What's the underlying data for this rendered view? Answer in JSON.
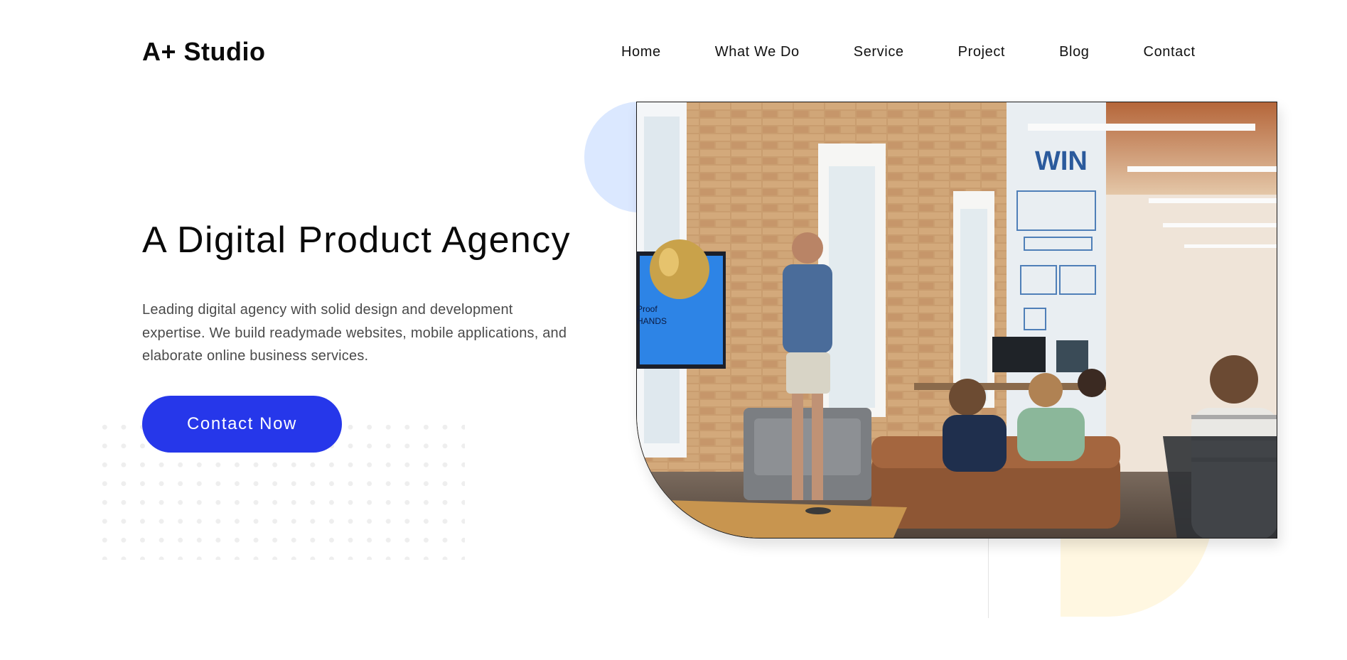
{
  "header": {
    "brand": "A+ Studio",
    "nav": [
      "Home",
      "What We Do",
      "Service",
      "Project",
      "Blog",
      "Contact"
    ]
  },
  "hero": {
    "title": "A Digital Product Agency",
    "description": "Leading digital agency with solid design and development expertise. We build readymade websites, mobile applications, and elaborate online business services.",
    "cta_label": "Contact Now",
    "image_alt": "team-meeting-photo"
  },
  "colors": {
    "accent": "#2637ea",
    "decor_blue": "#dbe8ff",
    "decor_yellow": "#fff7e1",
    "text": "#0b0b0b",
    "muted_text": "#4a4a4a"
  }
}
